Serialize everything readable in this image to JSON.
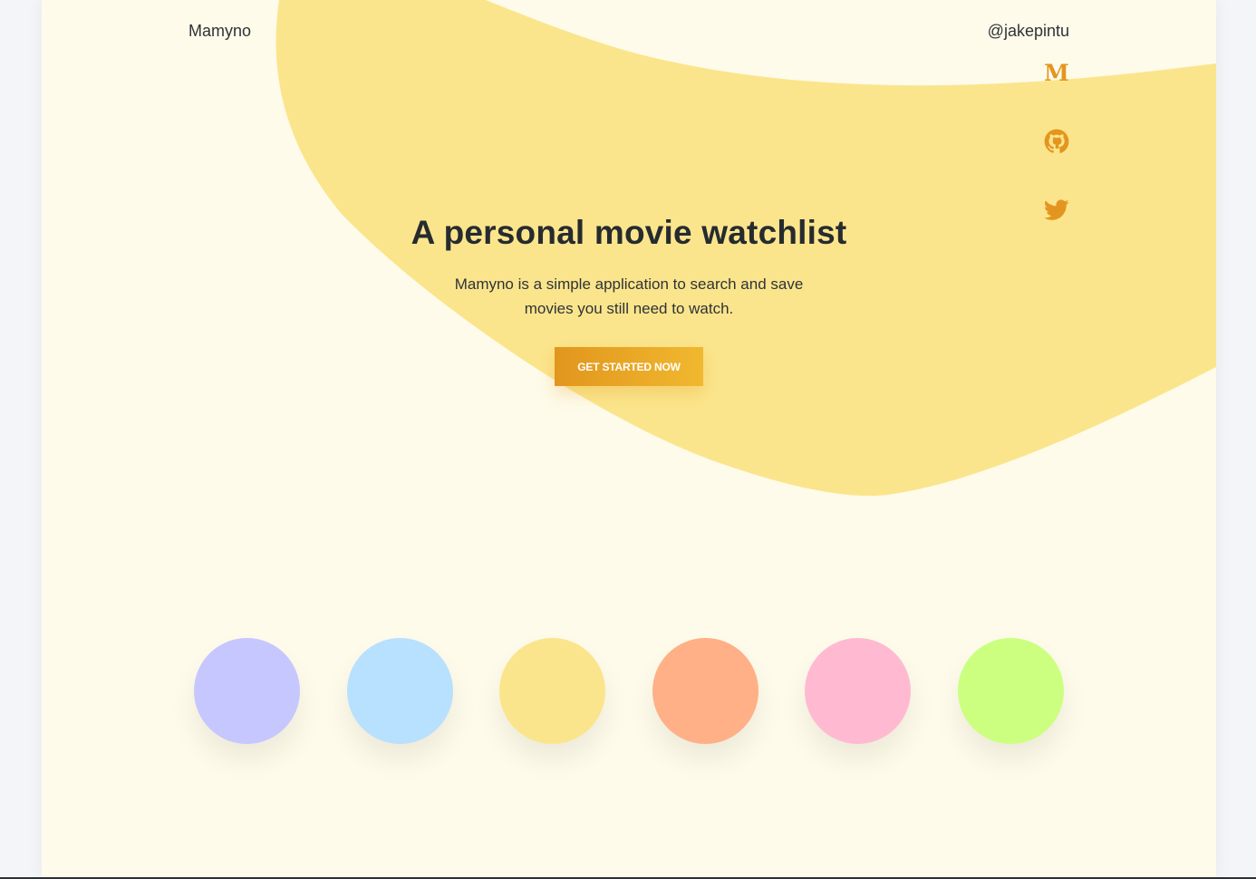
{
  "header": {
    "brand": "Mamyno",
    "handle": "@jakepintu"
  },
  "social": [
    {
      "name": "medium",
      "icon": "medium-icon",
      "glyph": "M"
    },
    {
      "name": "github",
      "icon": "github-icon"
    },
    {
      "name": "twitter",
      "icon": "twitter-icon"
    }
  ],
  "hero": {
    "title": "A personal movie watchlist",
    "subtitle": "Mamyno is a simple application to search and save movies you still need to watch.",
    "cta_label": "GET STARTED NOW"
  },
  "swatches": [
    {
      "name": "lavender",
      "color": "#c6c7ff"
    },
    {
      "name": "light-blue",
      "color": "#b8e0ff"
    },
    {
      "name": "yellow",
      "color": "#fbe58c"
    },
    {
      "name": "peach",
      "color": "#ffb087"
    },
    {
      "name": "pink",
      "color": "#ffbad2"
    },
    {
      "name": "lime",
      "color": "#ccff80"
    }
  ],
  "colors": {
    "background": "#fefbea",
    "blob": "#fbe58c",
    "accent": "#e3961f",
    "text": "#262b2f"
  }
}
